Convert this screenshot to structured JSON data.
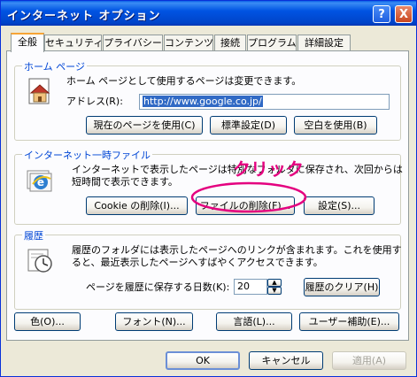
{
  "window": {
    "title": "インターネット オプション",
    "help_glyph": "?",
    "close_glyph": "X"
  },
  "tabs": [
    {
      "label": "全般",
      "active": true
    },
    {
      "label": "セキュリティ"
    },
    {
      "label": "プライバシー"
    },
    {
      "label": "コンテンツ"
    },
    {
      "label": "接続"
    },
    {
      "label": "プログラム"
    },
    {
      "label": "詳細設定"
    }
  ],
  "home": {
    "title": "ホーム ページ",
    "description": "ホーム ページとして使用するページは変更できます。",
    "address_label": "アドレス(R):",
    "address_value": "http://www.google.co.jp/",
    "btn_current": "現在のページを使用(C)",
    "btn_default": "標準設定(D)",
    "btn_blank": "空白を使用(B)"
  },
  "temp": {
    "title": "インターネット一時ファイル",
    "description_line1": "インターネットで表示したページは特別なフォルダに保存され、次回からは",
    "description_line2": "短時間で表示できます。",
    "btn_cookie": "Cookie の削除(I)...",
    "btn_files": "ファイルの削除(F)...",
    "btn_settings": "設定(S)..."
  },
  "history": {
    "title": "履歴",
    "description_line1": "履歴のフォルダには表示したページへのリンクが含まれます。これを使用す",
    "description_line2": "ると、最近表示したページへすばやくアクセスできます。",
    "days_label": "ページを履歴に保存する日数(K):",
    "days_value": "20",
    "btn_clear": "履歴のクリア(H)"
  },
  "bottom_buttons": {
    "colors": "色(O)...",
    "fonts": "フォント(N)...",
    "languages": "言語(L)...",
    "accessibility": "ユーザー補助(E)..."
  },
  "dialog_buttons": {
    "ok": "OK",
    "cancel": "キャンセル",
    "apply": "適用(A)"
  },
  "annotation": {
    "text": "クリック",
    "color": "#e4007f"
  }
}
